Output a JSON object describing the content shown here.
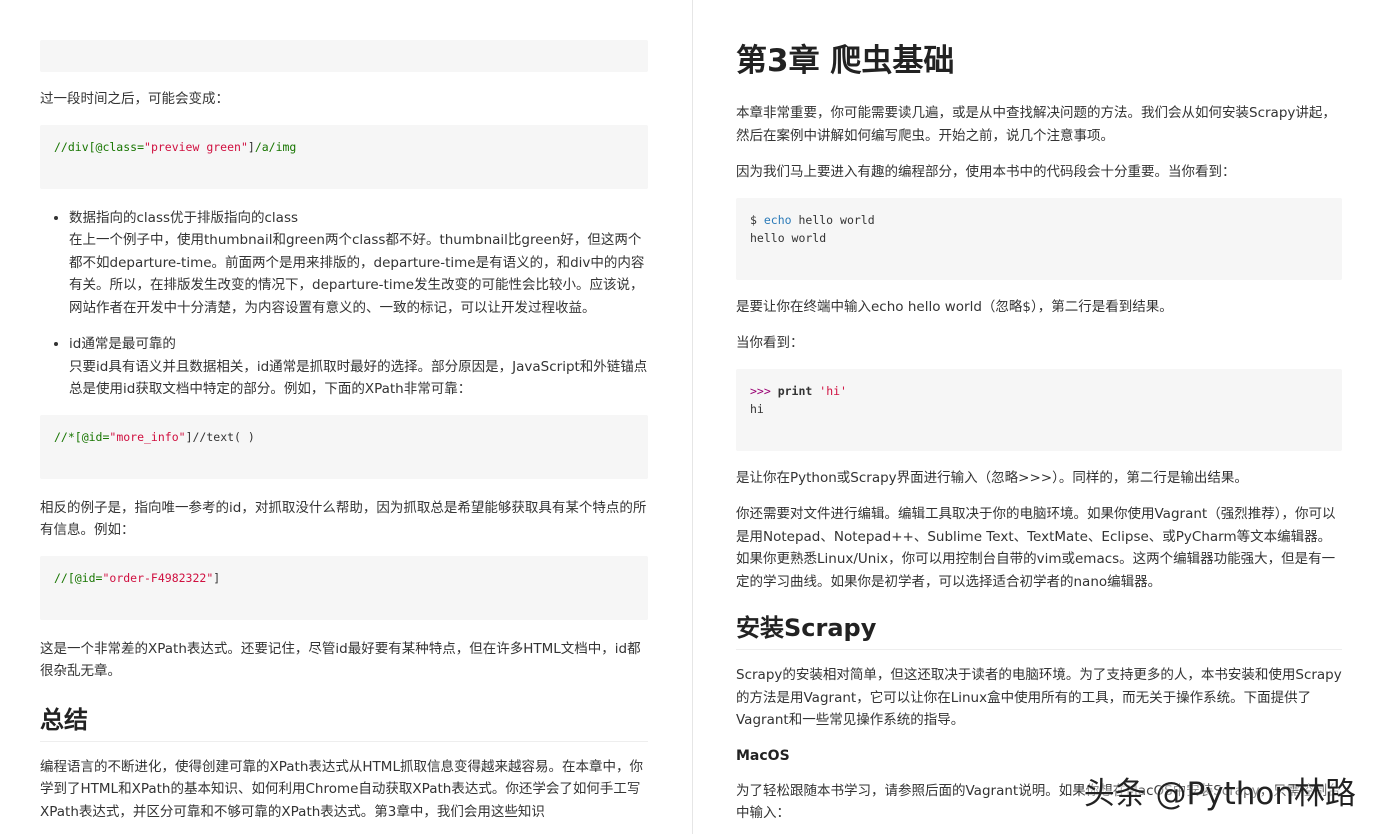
{
  "left": {
    "code_before_text": "",
    "p1": "过一段时间之后，可能会变成：",
    "code1": {
      "a": "//div[@class=",
      "b": "\"preview green\"",
      "c": "]",
      "d": "/a/img"
    },
    "bullet1_title": "数据指向的class优于排版指向的class",
    "bullet1_body": "在上一个例子中，使用thumbnail和green两个class都不好。thumbnail比green好，但这两个都不如departure-time。前面两个是用来排版的，departure-time是有语义的，和div中的内容有关。所以，在排版发生改变的情况下，departure-time发生改变的可能性会比较小。应该说，网站作者在开发中十分清楚，为内容设置有意义的、一致的标记，可以让开发过程收益。",
    "bullet2_title": "id通常是最可靠的",
    "bullet2_body": "只要id具有语义并且数据相关，id通常是抓取时最好的选择。部分原因是，JavaScript和外链锚点总是使用id获取文档中特定的部分。例如，下面的XPath非常可靠：",
    "code2": {
      "a": "//*[@id=",
      "b": "\"more_info\"",
      "c": "]",
      "d": "//text( )"
    },
    "p2": "相反的例子是，指向唯一参考的id，对抓取没什么帮助，因为抓取总是希望能够获取具有某个特点的所有信息。例如：",
    "code3": {
      "a": "//[@id=",
      "b": "\"order-F4982322\"",
      "c": "]"
    },
    "p3": "这是一个非常差的XPath表达式。还要记住，尽管id最好要有某种特点，但在许多HTML文档中，id都很杂乱无章。",
    "h_summary": "总结",
    "p4": "编程语言的不断进化，使得创建可靠的XPath表达式从HTML抓取信息变得越来越容易。在本章中，你学到了HTML和XPath的基本知识、如何利用Chrome自动获取XPath表达式。你还学会了如何手工写XPath表达式，并区分可靠和不够可靠的XPath表达式。第3章中，我们会用这些知识"
  },
  "right": {
    "chapter_title": "第3章 爬虫基础",
    "p1": "本章非常重要，你可能需要读几遍，或是从中查找解决问题的方法。我们会从如何安装Scrapy讲起，然后在案例中讲解如何编写爬虫。开始之前，说几个注意事项。",
    "p2": "因为我们马上要进入有趣的编程部分，使用本书中的代码段会十分重要。当你看到：",
    "code1": {
      "prompt": "$ ",
      "cmd": "echo",
      "rest": " hello world",
      "out": "hello world"
    },
    "p3": "是要让你在终端中输入echo hello world（忽略$），第二行是看到结果。",
    "p4": "当你看到：",
    "code2": {
      "prompt": ">>> ",
      "kw": "print",
      "str": "'hi'",
      "out": "hi"
    },
    "p5": "是让你在Python或Scrapy界面进行输入（忽略>>>）。同样的，第二行是输出结果。",
    "p6": "你还需要对文件进行编辑。编辑工具取决于你的电脑环境。如果你使用Vagrant（强烈推荐），你可以是用Notepad、Notepad++、Sublime Text、TextMate、Eclipse、或PyCharm等文本编辑器。如果你更熟悉Linux/Unix，你可以用控制台自带的vim或emacs。这两个编辑器功能强大，但是有一定的学习曲线。如果你是初学者，可以选择适合初学者的nano编辑器。",
    "h_install": "安装Scrapy",
    "p7": "Scrapy的安装相对简单，但这还取决于读者的电脑环境。为了支持更多的人，本书安装和使用Scrapy的方法是用Vagrant，它可以让你在Linux盒中使用所有的工具，而无关于操作系统。下面提供了Vagrant和一些常见操作系统的指导。",
    "h_macos": "MacOS",
    "p8": "为了轻松跟随本书学习，请参照后面的Vagrant说明。如果你想在MacOS中安装Scrapy，只需控制台中输入："
  },
  "watermark": "头条 @Python林路"
}
